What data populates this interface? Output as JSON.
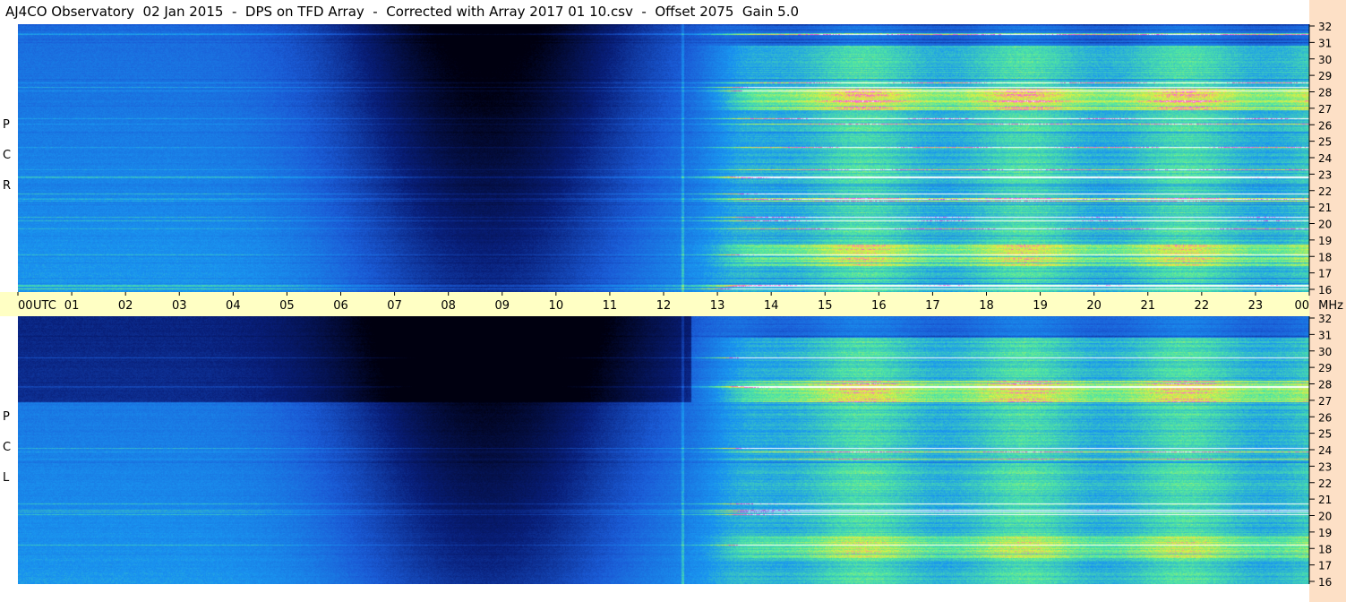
{
  "title": "AJ4CO Observatory  02 Jan 2015  -  DPS on TFD Array  -  Corrected with Array 2017 01 10.csv  -  Offset 2075  Gain 5.0",
  "panels": [
    {
      "id": "rcp",
      "label_letters": [
        "R",
        "C",
        "P"
      ]
    },
    {
      "id": "lcp",
      "label_letters": [
        "L",
        "C",
        "P"
      ]
    }
  ],
  "time_axis": {
    "labels": [
      "00",
      "01",
      "02",
      "03",
      "04",
      "05",
      "06",
      "07",
      "08",
      "09",
      "10",
      "11",
      "12",
      "13",
      "14",
      "15",
      "16",
      "17",
      "18",
      "19",
      "20",
      "21",
      "22",
      "23",
      "00"
    ],
    "utc_label": "UTC",
    "mhz_label": "MHz"
  },
  "chart_data": {
    "type": "heatmap",
    "title": "AJ4CO Observatory  02 Jan 2015  -  DPS on TFD Array  -  Corrected with Array 2017 01 10.csv  -  Offset 2075  Gain 5.0",
    "x": {
      "unit": "UTC hour",
      "range": [
        0,
        24
      ],
      "ticks": [
        "00",
        "01",
        "02",
        "03",
        "04",
        "05",
        "06",
        "07",
        "08",
        "09",
        "10",
        "11",
        "12",
        "13",
        "14",
        "15",
        "16",
        "17",
        "18",
        "19",
        "20",
        "21",
        "22",
        "23",
        "00"
      ]
    },
    "y": {
      "unit": "MHz",
      "range": [
        16,
        32
      ],
      "ticks": [
        32,
        31,
        30,
        29,
        28,
        27,
        26,
        25,
        24,
        23,
        22,
        21,
        20,
        19,
        18,
        17,
        16
      ]
    },
    "panels": [
      "RCP",
      "LCP"
    ],
    "colors": {
      "low": "#000010",
      "mid": "#1a5bd6",
      "high": "#52e8a0",
      "peak": "#ff4de1",
      "max": "#ffffff"
    }
  }
}
